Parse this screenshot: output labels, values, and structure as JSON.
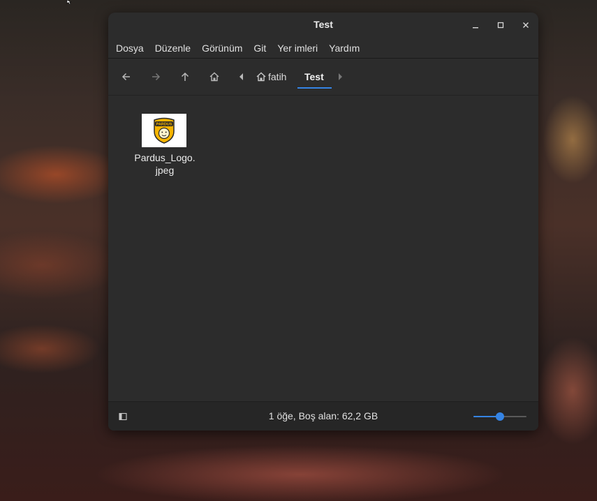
{
  "window": {
    "title": "Test"
  },
  "menubar": {
    "items": [
      {
        "label": "Dosya"
      },
      {
        "label": "Düzenle"
      },
      {
        "label": "Görünüm"
      },
      {
        "label": "Git"
      },
      {
        "label": "Yer imleri"
      },
      {
        "label": "Yardım"
      }
    ]
  },
  "toolbar": {
    "breadcrumbs": {
      "home_label": "fatih",
      "current_label": "Test"
    }
  },
  "files": [
    {
      "name": "Pardus_Logo.\njpeg",
      "thumb_text": "PARDUS"
    }
  ],
  "statusbar": {
    "text": "1 öğe, Boş alan: 62,2 GB",
    "zoom_level": 0.5
  },
  "colors": {
    "accent": "#3584e4",
    "window_bg": "#2c2c2c",
    "logo_yellow": "#f5b400"
  }
}
